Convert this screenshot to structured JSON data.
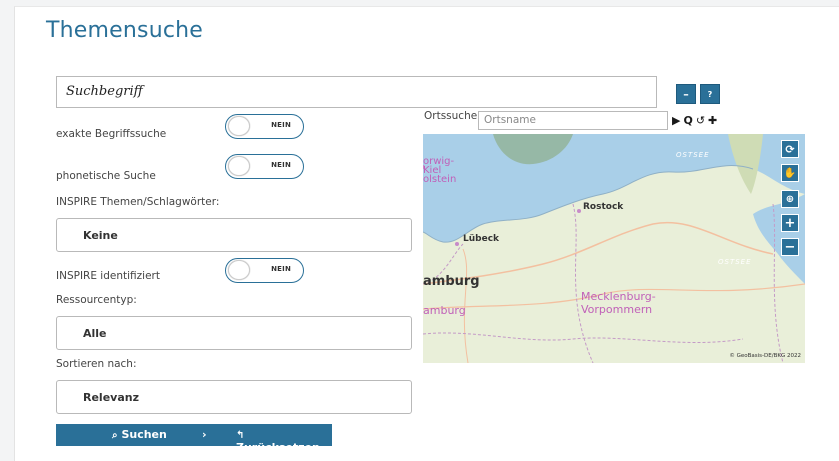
{
  "page": {
    "title": "Themensuche"
  },
  "search": {
    "value": "Suchbegriff",
    "collapse_label": "–",
    "help_label": "?"
  },
  "options": {
    "exact": {
      "label": "exakte Begriffssuche",
      "state": "NEIN"
    },
    "phonetic": {
      "label": "phonetische Suche",
      "state": "NEIN"
    },
    "inspire_topics": {
      "label": "INSPIRE Themen/Schlagwörter:",
      "value": "Keine"
    },
    "inspire_identified": {
      "label": "INSPIRE identifiziert",
      "state": "NEIN"
    },
    "resource_type": {
      "label": "Ressourcentyp:",
      "value": "Alle"
    },
    "sort": {
      "label": "Sortieren nach:",
      "value": "Relevanz"
    }
  },
  "actions": {
    "search_label": "Suchen",
    "separator": "›",
    "reset_label": "Zurücksetzen"
  },
  "map": {
    "place_search_label": "Ortssuche:",
    "place_search_placeholder": "Ortsname",
    "labels": {
      "city1": "Rostock",
      "city2": "Lübeck",
      "city3": "amburg",
      "city3b": "amburg",
      "state1": "orwig-",
      "state1b": "olstein",
      "kiel": "Kiel",
      "region1": "Mecklenburg-",
      "region1b": "Vorpommern",
      "sea1": "OSTSEE",
      "sea2": "OSTSEE"
    },
    "attribution": "© GeoBasis-DE/BKG 2022"
  },
  "icons": {
    "play": "play-icon",
    "search": "search-icon",
    "reset": "undo-icon",
    "pin": "pin-icon"
  }
}
